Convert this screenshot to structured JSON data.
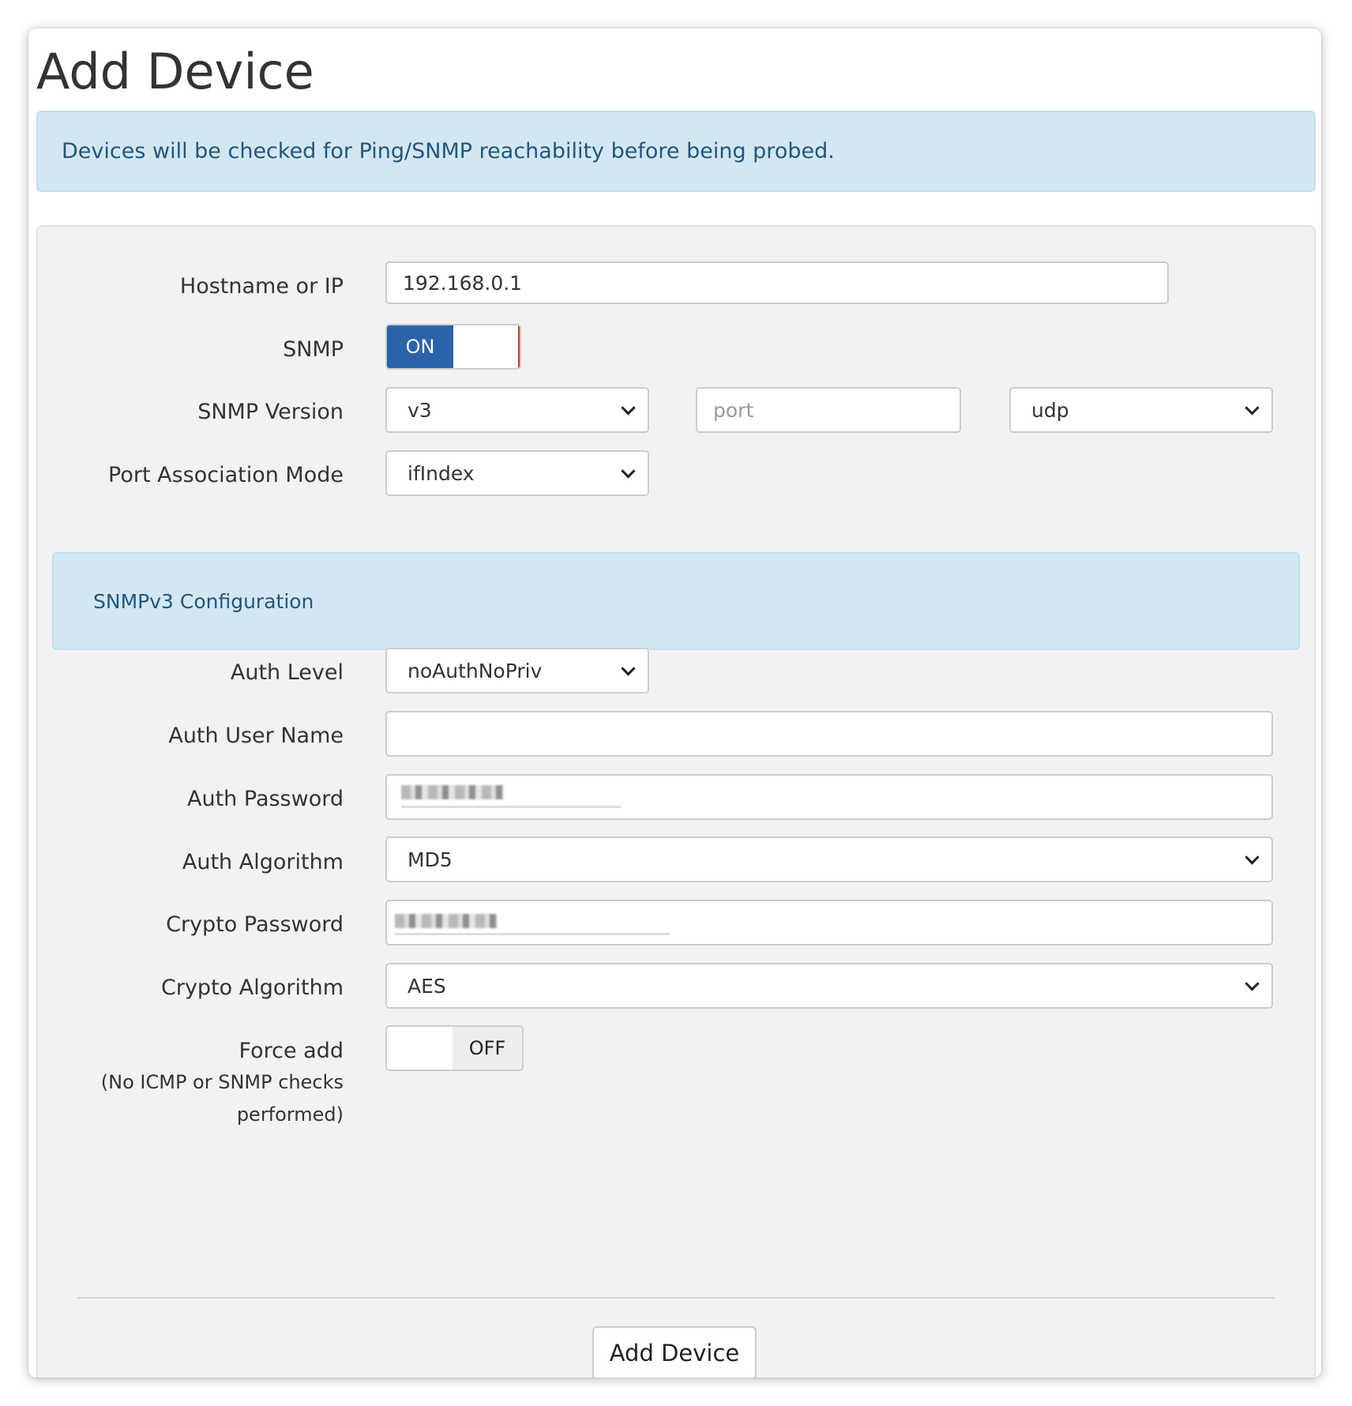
{
  "title": "Add Device",
  "info_message": "Devices will be checked for Ping/SNMP reachability before being probed.",
  "form": {
    "hostname": {
      "label": "Hostname or IP",
      "value": "192.168.0.1"
    },
    "snmp": {
      "label": "SNMP",
      "state_label": "ON"
    },
    "snmp_version": {
      "label": "SNMP Version",
      "selected": "v3",
      "port_placeholder": "port",
      "transport": "udp"
    },
    "port_association": {
      "label": "Port Association Mode",
      "selected": "ifIndex"
    },
    "snmpv3_heading": "SNMPv3 Configuration",
    "auth_level": {
      "label": "Auth Level",
      "selected": "noAuthNoPriv"
    },
    "auth_user": {
      "label": "Auth User Name",
      "value": ""
    },
    "auth_password": {
      "label": "Auth Password"
    },
    "auth_algorithm": {
      "label": "Auth Algorithm",
      "selected": "MD5"
    },
    "crypto_password": {
      "label": "Crypto Password"
    },
    "crypto_algorithm": {
      "label": "Crypto Algorithm",
      "selected": "AES"
    },
    "force_add": {
      "label": "Force add",
      "note_line1": "(No ICMP or SNMP checks",
      "note_line2": "performed)",
      "state_label": "OFF"
    },
    "submit_label": "Add Device"
  },
  "colors": {
    "accent": "#2a63a8",
    "info_background": "#d3e7f3",
    "info_text": "#22577a"
  }
}
